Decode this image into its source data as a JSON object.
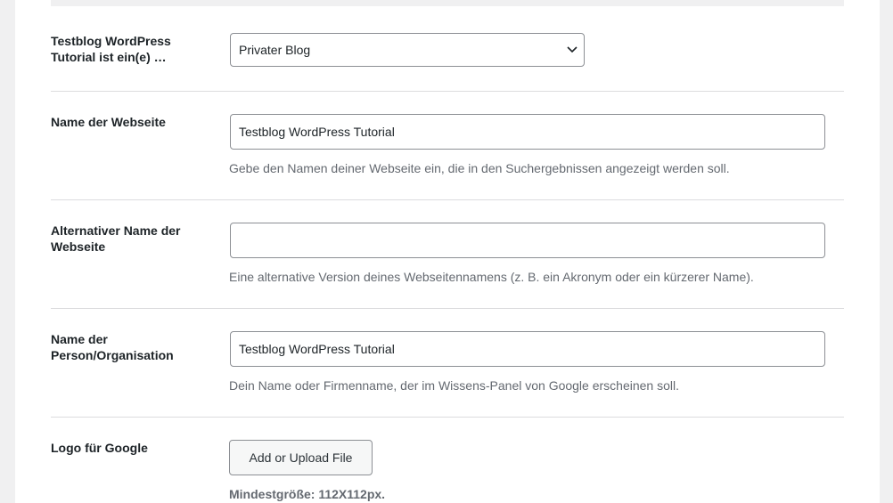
{
  "fields": {
    "site_type": {
      "label": "Testblog WordPress Tutorial ist ein(e) …",
      "selected": "Privater Blog"
    },
    "site_name": {
      "label": "Name der Webseite",
      "value": "Testblog WordPress Tutorial",
      "description": "Gebe den Namen deiner Webseite ein, die in den Suchergebnissen angezeigt werden soll."
    },
    "alt_site_name": {
      "label": "Alternativer Name der Webseite",
      "value": "",
      "description": "Eine alternative Version deines Webseitennamens (z. B. ein Akronym oder ein kürzerer Name)."
    },
    "person_org_name": {
      "label": "Name der Person/Organisation",
      "value": "Testblog WordPress Tutorial",
      "description": "Dein Name oder Firmenname, der im Wissens-Panel von Google erscheinen soll."
    },
    "logo": {
      "label": "Logo für Google",
      "button_label": "Add or Upload File",
      "note": "Mindestgröße: 112X112px."
    }
  },
  "icons": {
    "select_arrow": "chevron-down-icon"
  }
}
